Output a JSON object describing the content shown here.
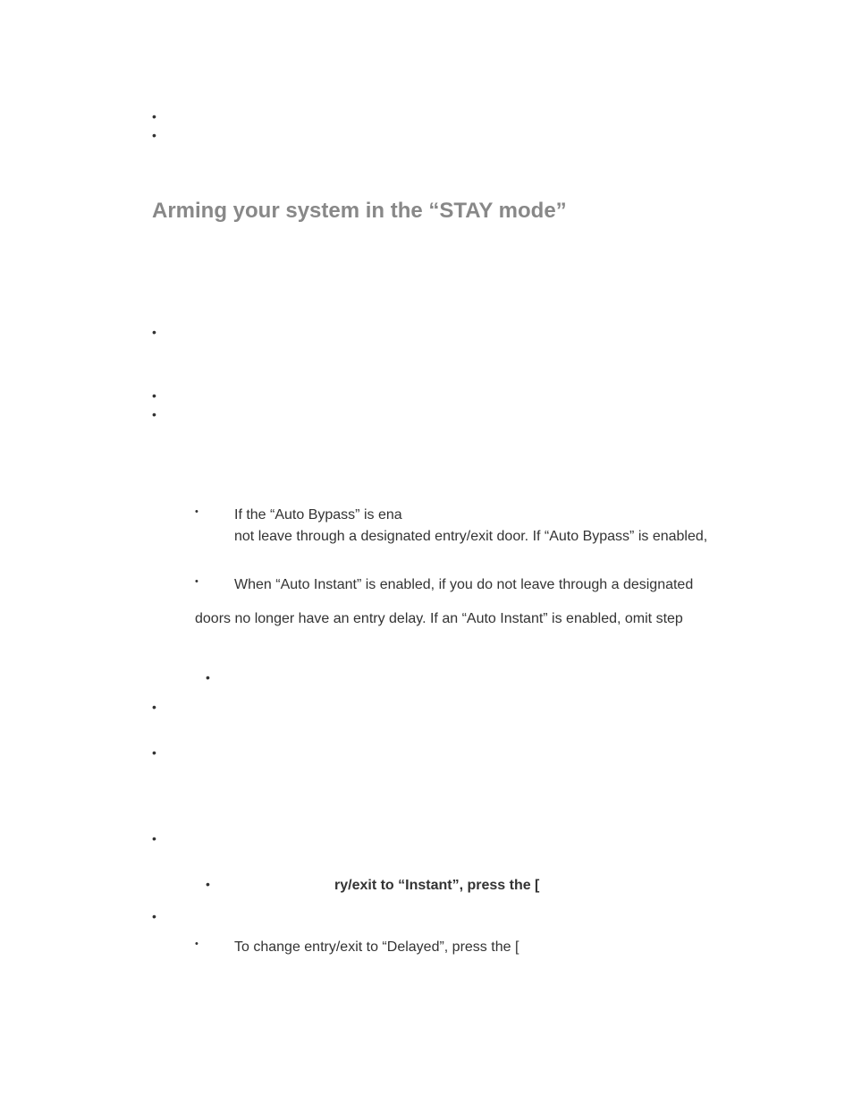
{
  "top": {
    "b0": "",
    "b1": ""
  },
  "heading": "Arming your system in the “STAY mode”",
  "list1": {
    "b0": "",
    "b1": "",
    "b2": ""
  },
  "list2": {
    "item0_line1": "If the “Auto Bypass” is ena",
    "item0_line2": "not leave through a designated entry/exit  door. If “Auto Bypass” is enabled,",
    "item1_line1": "When “Auto Instant” is enabled, if you do not leave through a designated",
    "item1_line2": "doors no longer have an entry delay. If an “Auto Instant” is enabled, omit step"
  },
  "list3": {
    "sub0": "",
    "b0": "",
    "b1": "",
    "b2": "",
    "sub2_bold": "ry/exit to “Instant”, press the [",
    "b3": "",
    "b4": "To change entry/exit to “Delayed”, press the ["
  }
}
